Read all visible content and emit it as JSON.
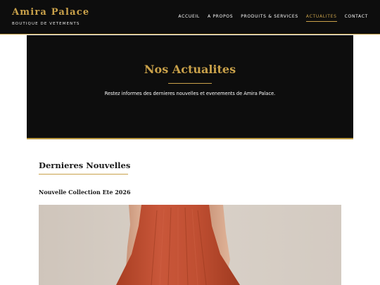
{
  "brand": {
    "name": "Amira Palace",
    "tagline": "BOUTIQUE DE VETEMENTS"
  },
  "nav": {
    "items": [
      {
        "label": "ACCUEIL"
      },
      {
        "label": "A PROPOS"
      },
      {
        "label": "PRODUITS & SERVICES"
      },
      {
        "label": "ACTUALITES"
      },
      {
        "label": "CONTACT"
      }
    ],
    "active": "ACTUALITES"
  },
  "hero": {
    "title": "Nos Actualites",
    "subtitle": "Restez informes des dernieres nouvelles et evenements de Amira Palace."
  },
  "news": {
    "section_title": "Dernieres Nouvelles",
    "articles": [
      {
        "title": "Nouvelle Collection Ete 2026"
      }
    ]
  },
  "colors": {
    "accent_gold": "#c9a14a",
    "header_bg": "#0d0d0d",
    "dress": "#c2512f"
  }
}
